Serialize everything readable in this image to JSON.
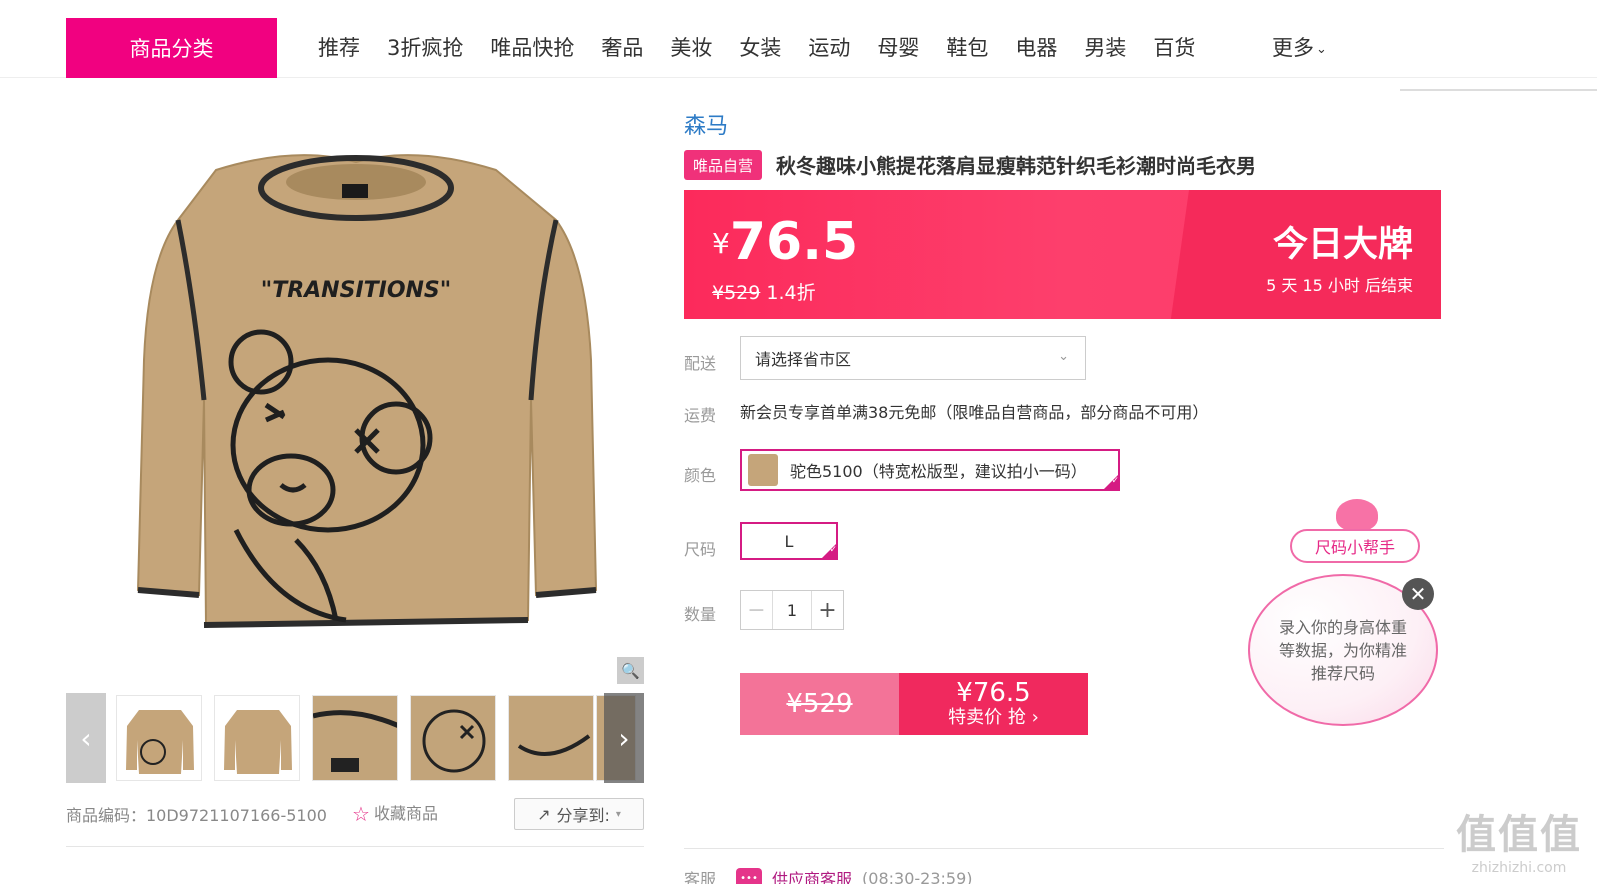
{
  "nav": {
    "category_button": "商品分类",
    "items": [
      "推荐",
      "3折疯抢",
      "唯品快抢",
      "奢品",
      "美妆",
      "女装",
      "运动",
      "母婴",
      "鞋包",
      "电器",
      "男装",
      "百货"
    ],
    "more": "更多"
  },
  "product": {
    "brand": "森马",
    "self_badge": "唯品自营",
    "title": "秋冬趣味小熊提花落肩显瘦韩范针织毛衫潮时尚毛衣男",
    "image_text": "\"TRANSITIONS\"",
    "sku": "商品编码：10D9721107166-5100",
    "favorite": "收藏商品",
    "share": "分享到:"
  },
  "price": {
    "currency": "¥",
    "current": "76.5",
    "original": "¥529",
    "discount": "1.4折",
    "banner_title": "今日大牌",
    "countdown": "5  天  15  小时 后结束"
  },
  "delivery": {
    "label": "配送",
    "placeholder": "请选择省市区"
  },
  "shipping": {
    "label": "运费",
    "text": "新会员专享首单满38元免邮（限唯品自营商品，部分商品不可用）"
  },
  "color": {
    "label": "颜色",
    "selected": "驼色5100（特宽松版型，建议拍小一码）"
  },
  "size": {
    "label": "尺码",
    "selected": "L"
  },
  "quantity": {
    "label": "数量",
    "value": "1",
    "minus": "−",
    "plus": "+"
  },
  "buy": {
    "original_price": "¥529",
    "price": "¥76.5",
    "label": "特卖价 抢 ›"
  },
  "service": {
    "label": "客服",
    "link": "供应商客服",
    "hours": "(08:30-23:59)"
  },
  "size_helper": {
    "tag": "尺码小帮手",
    "text": "录入你的身高体重等数据，为你精准推荐尺码"
  },
  "watermark": {
    "big": "值值值",
    "small": "zhizhizhi.com"
  },
  "colors": {
    "brand_pink": "#f10180",
    "price_red": "#fc2a5b",
    "brand_blue": "#2d7bc6",
    "sweater_tan": "#c5a57a"
  }
}
